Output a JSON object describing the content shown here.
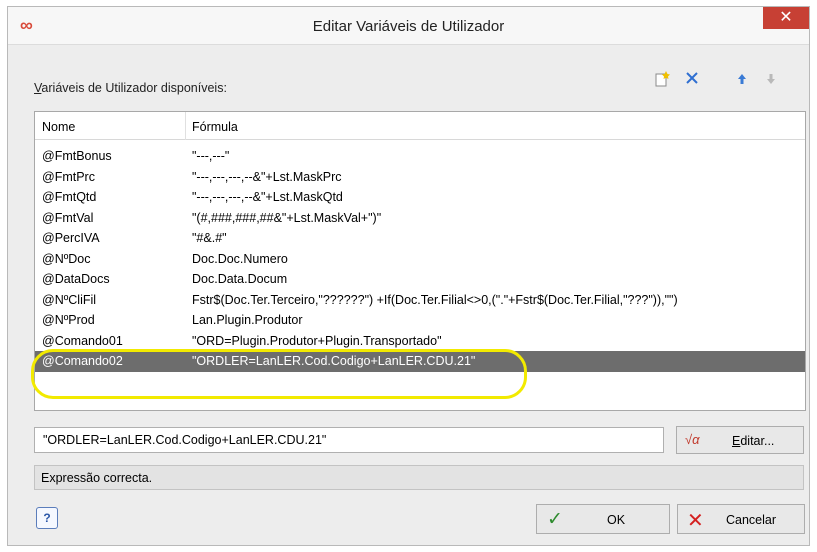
{
  "window": {
    "title": "Editar Variáveis de Utilizador",
    "app_icon": "∞",
    "close_symbol": "✕"
  },
  "list_label_prefix": "V",
  "list_label_rest": "ariáveis de Utilizador disponíveis:",
  "toolbar": {
    "new_icon": "new-item-icon",
    "delete_icon": "delete-x-icon",
    "up_icon": "arrow-up-icon",
    "down_icon": "arrow-down-icon"
  },
  "table": {
    "columns": [
      "Nome",
      "Fórmula"
    ],
    "rows": [
      {
        "name": "@FmtBonus",
        "formula": "\"---,---\""
      },
      {
        "name": "@FmtPrc",
        "formula": "\"---,---,---,--&\"+Lst.MaskPrc"
      },
      {
        "name": "@FmtQtd",
        "formula": "\"---,---,---,--&\"+Lst.MaskQtd"
      },
      {
        "name": "@FmtVal",
        "formula": "\"(#,###,###,##&\"+Lst.MaskVal+\")\""
      },
      {
        "name": "@PercIVA",
        "formula": "\"#&.#\""
      },
      {
        "name": "@NºDoc",
        "formula": "Doc.Doc.Numero"
      },
      {
        "name": "@DataDocs",
        "formula": "Doc.Data.Docum"
      },
      {
        "name": "@NºCliFil",
        "formula": "Fstr$(Doc.Ter.Terceiro,\"??????\") +If(Doc.Ter.Filial<>0,(\".\"+Fstr$(Doc.Ter.Filial,\"???\")),\"\")"
      },
      {
        "name": "@NºProd",
        "formula": "Lan.Plugin.Produtor"
      },
      {
        "name": "@Comando01",
        "formula": "\"ORD=Plugin.Produtor+Plugin.Transportado\""
      },
      {
        "name": "@Comando02",
        "formula": "\"ORDLER=LanLER.Cod.Codigo+LanLER.CDU.21\""
      }
    ],
    "selected_index": 10
  },
  "expression": {
    "value": "\"ORDLER=LanLER.Cod.Codigo+LanLER.CDU.21\"",
    "editar_prefix": "E",
    "editar_rest": "ditar..."
  },
  "status": "Expressão correcta.",
  "buttons": {
    "ok": "OK",
    "cancel": "Cancelar"
  },
  "colors": {
    "selected_row": "#6d6d6d",
    "highlight": "#f2ea00",
    "close": "#c74034"
  }
}
